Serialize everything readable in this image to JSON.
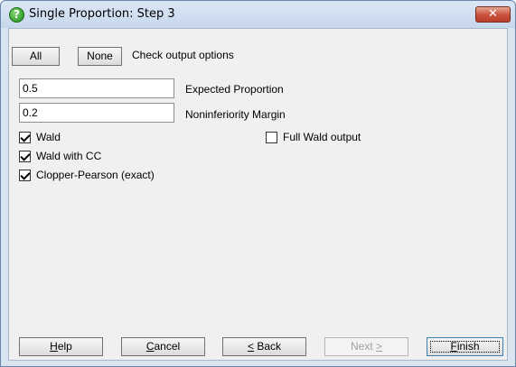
{
  "window": {
    "title": "Single Proportion: Step 3",
    "close_glyph": "✕",
    "help_icon": "question-circle-icon"
  },
  "toolbar": {
    "all_label": "All",
    "none_label": "None",
    "caption": "Check output options"
  },
  "fields": {
    "expected_proportion": {
      "value": "0.5",
      "label": "Expected Proportion"
    },
    "noninferiority_margin": {
      "value": "0.2",
      "label": "Noninferiority Margin"
    }
  },
  "options": {
    "wald": {
      "label": "Wald",
      "checked": true
    },
    "wald_cc": {
      "label": "Wald with CC",
      "checked": true
    },
    "clopper_pearson": {
      "label": "Clopper-Pearson (exact)",
      "checked": true
    },
    "full_wald": {
      "label": "Full Wald output",
      "checked": false
    }
  },
  "buttons": {
    "help": {
      "first": "H",
      "rest": "elp"
    },
    "cancel": {
      "first": "C",
      "rest": "ancel"
    },
    "back": {
      "first": "<",
      "rest": " Back"
    },
    "next": {
      "first": "Next ",
      "rest": ">"
    },
    "finish": {
      "first": "F",
      "rest": "inish"
    }
  }
}
